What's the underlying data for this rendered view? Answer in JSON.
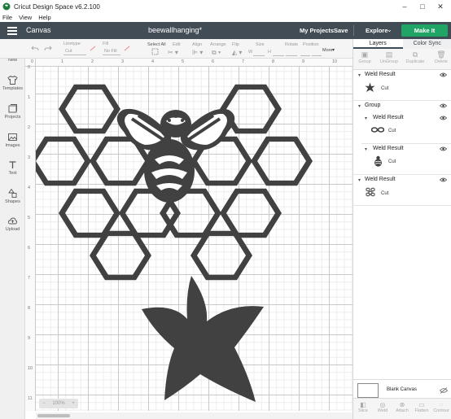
{
  "app": {
    "title": "Cricut Design Space  v6.2.100"
  },
  "menu": [
    "File",
    "View",
    "Help"
  ],
  "header": {
    "canvas_label": "Canvas",
    "project_title": "beewallhanging*",
    "my_projects": "My Projects",
    "save": "Save",
    "explore": "Explore",
    "make_it": "Make It"
  },
  "toolbar": {
    "linetype": "Linetype",
    "linetype_val": "Cut",
    "fill": "Fill",
    "fill_val": "No Fill",
    "select_all": "Select All",
    "edit": "Edit",
    "align": "Align",
    "arrange": "Arrange",
    "flip": "Flip",
    "size": "Size",
    "w": "W",
    "h": "H",
    "rotate": "Rotate",
    "position": "Position",
    "more": "More"
  },
  "leftnav": [
    {
      "label": "New",
      "icon": "plus-circle-icon"
    },
    {
      "label": "Templates",
      "icon": "shirt-icon"
    },
    {
      "label": "Projects",
      "icon": "projects-icon"
    },
    {
      "label": "Images",
      "icon": "image-icon"
    },
    {
      "label": "Text",
      "icon": "text-icon"
    },
    {
      "label": "Shapes",
      "icon": "shapes-icon"
    },
    {
      "label": "Upload",
      "icon": "upload-icon"
    }
  ],
  "rulers": {
    "top": [
      "0",
      "1",
      "2",
      "3",
      "4",
      "5",
      "6",
      "7",
      "8",
      "9",
      "10"
    ],
    "left": [
      "0",
      "1",
      "2",
      "3",
      "4",
      "5",
      "6",
      "7",
      "8",
      "9",
      "10",
      "11"
    ]
  },
  "zoom": {
    "value": "100%",
    "minus": "−",
    "plus": "+"
  },
  "panel": {
    "tabs": [
      "Layers",
      "Color Sync"
    ],
    "tools": [
      "Group",
      "UnGroup",
      "Duplicate",
      "Delete"
    ],
    "layers": [
      {
        "name": "Weld Result",
        "cut": "Cut",
        "icon": "star-thumb-icon"
      },
      {
        "name": "Group"
      },
      {
        "name": "Weld Result",
        "cut": "Cut",
        "icon": "antenna-thumb-icon"
      },
      {
        "name": "Weld Result",
        "cut": "Cut",
        "icon": "bee-thumb-icon"
      },
      {
        "name": "Weld Result",
        "cut": "Cut",
        "icon": "honeycomb-thumb-icon"
      }
    ],
    "blank_canvas": "Blank Canvas",
    "bottom_tools": [
      "Slice",
      "Weld",
      "Attach",
      "Flatten",
      "Contour"
    ]
  },
  "colors": {
    "header": "#414c55",
    "make_it": "#20a566",
    "artwork": "#414141"
  }
}
